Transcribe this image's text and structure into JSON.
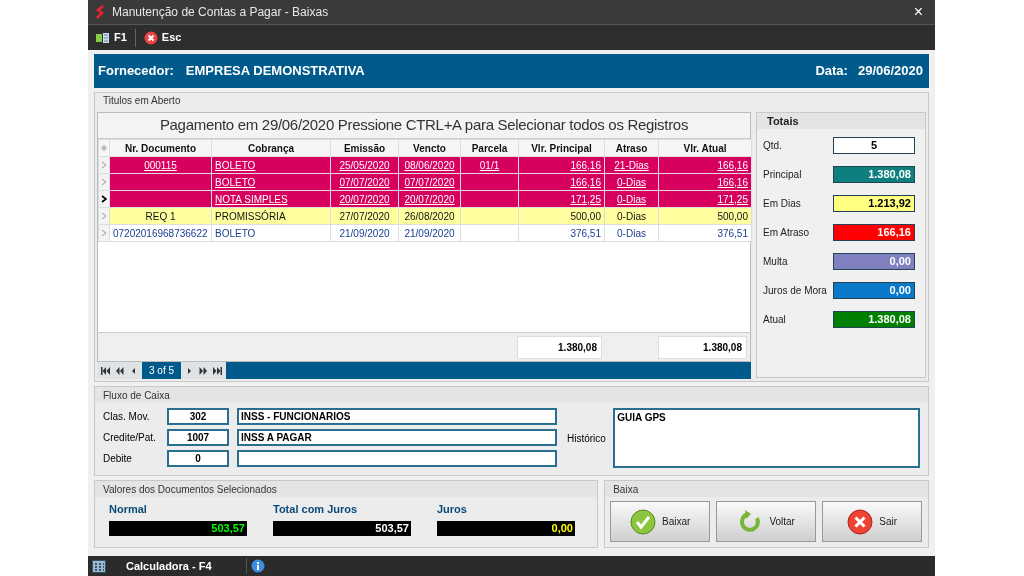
{
  "window": {
    "title": "Manutenção de Contas a Pagar - Baixas",
    "close": "×"
  },
  "toolbar": [
    {
      "kind": "f1",
      "label": "F1"
    },
    {
      "kind": "esc",
      "label": "Esc"
    }
  ],
  "header": {
    "supplier_label": "Fornecedor:",
    "supplier": "EMPRESA DEMONSTRATIVA",
    "date_label": "Data:",
    "date": "29/06/2020"
  },
  "open_titles": {
    "title": "Titulos em Aberto",
    "caption": "Pagamento em 29/06/2020 Pressione CTRL+A para Selecionar todos os Registros",
    "columns": [
      "Nr. Documento",
      "Cobrança",
      "Emissão",
      "Vencto",
      "Parcela",
      "Vlr. Principal",
      "Atraso",
      "Vlr. Atual"
    ],
    "rows": [
      {
        "selected": true,
        "highlighted": false,
        "current": false,
        "cells": [
          "000115",
          "BOLETO",
          "25/05/2020",
          "08/06/2020",
          "01/1",
          "166,16",
          "21-Dias",
          "166,16"
        ]
      },
      {
        "selected": true,
        "highlighted": false,
        "current": false,
        "cells": [
          "",
          "BOLETO",
          "07/07/2020",
          "07/07/2020",
          "",
          "166,16",
          "0-Dias",
          "166,16"
        ]
      },
      {
        "selected": true,
        "highlighted": false,
        "current": true,
        "cells": [
          "",
          "NOTA SIMPLES",
          "20/07/2020",
          "20/07/2020",
          "",
          "171,25",
          "0-Dias",
          "171,25"
        ]
      },
      {
        "selected": false,
        "highlighted": true,
        "current": false,
        "cells": [
          "REQ 1",
          "PROMISSÓRIA",
          "27/07/2020",
          "26/08/2020",
          "",
          "500,00",
          "0-Dias",
          "500,00"
        ]
      },
      {
        "selected": false,
        "highlighted": false,
        "current": false,
        "cells": [
          "07202016968736622",
          "BOLETO",
          "21/09/2020",
          "21/09/2020",
          "",
          "376,51",
          "0-Dias",
          "376,51"
        ]
      }
    ],
    "footer_principal": "1.380,08",
    "footer_atual": "1.380,08",
    "navigator": "3 of 5"
  },
  "totals": {
    "title": "Totais",
    "items": [
      {
        "label": "Qtd.",
        "value": "5",
        "color": "#ffffff"
      },
      {
        "label": "Principal",
        "value": "1.380,08",
        "color": "#0e7f7f"
      },
      {
        "label": "Em Dias",
        "value": "1.213,92",
        "color": "#ffff80"
      },
      {
        "label": "Em Atraso",
        "value": "166,16",
        "color": "#ff0000"
      },
      {
        "label": "Multa",
        "value": "0,00",
        "color": "#8080c0"
      },
      {
        "label": "Juros de Mora",
        "value": "0,00",
        "color": "#0a78c8"
      },
      {
        "label": "Atual",
        "value": "1.380,08",
        "color": "#008000"
      }
    ]
  },
  "cash_flow": {
    "title": "Fluxo de Caixa",
    "rows": [
      {
        "label": "Clas. Mov.",
        "code": "302",
        "description": "INSS - FUNCIONARIOS"
      },
      {
        "label": "Credite/Pat.",
        "code": "1007",
        "description": "INSS A PAGAR"
      },
      {
        "label": "Debite",
        "code": "0",
        "description": ""
      }
    ],
    "history_label": "Histórico",
    "history": "GUIA GPS"
  },
  "selected_values": {
    "title": "Valores dos Documentos Selecionados",
    "items": [
      {
        "kind": "normal",
        "label": "Normal",
        "value": "503,57"
      },
      {
        "kind": "total",
        "label": "Total com Juros",
        "value": "503,57"
      },
      {
        "kind": "interest",
        "label": "Juros",
        "value": "0,00"
      }
    ]
  },
  "write_off": {
    "title": "Baixa",
    "buttons": [
      {
        "kind": "confirm",
        "label": "Baixar"
      },
      {
        "kind": "back",
        "label": "Voltar"
      },
      {
        "kind": "exit",
        "label": "Sair"
      }
    ]
  },
  "status_bar": {
    "calculator": "Calculadora - F4"
  }
}
